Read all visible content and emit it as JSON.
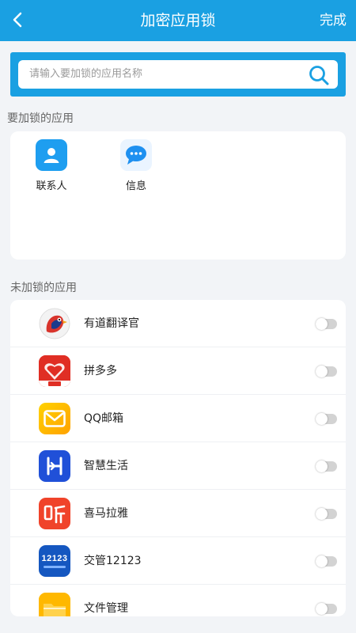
{
  "header": {
    "title": "加密应用锁",
    "done_label": "完成",
    "back_icon": "chevron-left-icon"
  },
  "search": {
    "placeholder": "请输入要加锁的应用名称",
    "icon": "search-icon"
  },
  "locked_section": {
    "label": "要加锁的应用",
    "apps": [
      {
        "name": "联系人",
        "icon": "contacts-icon"
      },
      {
        "name": "信息",
        "icon": "messages-icon"
      }
    ]
  },
  "unlocked_section": {
    "label": "未加锁的应用",
    "apps": [
      {
        "name": "有道翻译官",
        "icon": "youdao-translate-icon",
        "locked": false
      },
      {
        "name": "拼多多",
        "icon": "pinduoduo-icon",
        "locked": false
      },
      {
        "name": "QQ邮箱",
        "icon": "qq-mail-icon",
        "locked": false
      },
      {
        "name": "智慧生活",
        "icon": "smart-life-icon",
        "locked": false
      },
      {
        "name": "喜马拉雅",
        "icon": "ximalaya-icon",
        "locked": false
      },
      {
        "name": "交管12123",
        "icon": "traffic-12123-icon",
        "locked": false,
        "icon_text": "12123"
      },
      {
        "name": "文件管理",
        "icon": "file-manager-icon",
        "locked": false
      }
    ]
  },
  "colors": {
    "accent": "#1aa0e2",
    "background": "#f2f4f7",
    "toggle_off": "#d3d3d3"
  }
}
